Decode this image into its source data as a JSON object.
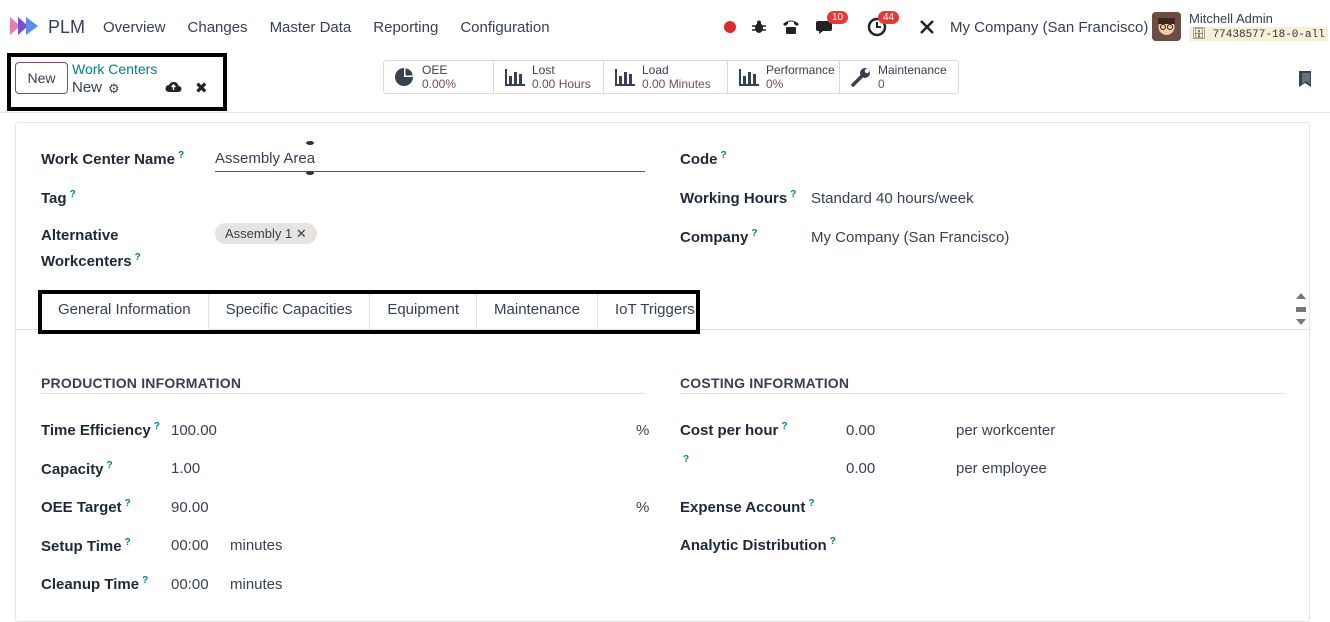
{
  "app": {
    "name": "PLM"
  },
  "nav": {
    "menu": [
      "Overview",
      "Changes",
      "Master Data",
      "Reporting",
      "Configuration"
    ]
  },
  "systray": {
    "messages_count": "10",
    "activities_count": "44",
    "company": "My Company (San Francisco)",
    "user_name": "Mitchell Admin",
    "db_name": "77438577-18-0-all"
  },
  "control": {
    "new_label": "New",
    "breadcrumb_parent": "Work Centers",
    "breadcrumb_current": "New"
  },
  "stats": [
    {
      "icon": "pie-chart-icon",
      "label": "OEE",
      "value": "0.00%"
    },
    {
      "icon": "bar-chart-icon",
      "label": "Lost",
      "value": "0.00 Hours"
    },
    {
      "icon": "bar-chart-icon",
      "label": "Load",
      "value": "0.00 Minutes"
    },
    {
      "icon": "bar-chart-icon",
      "label": "Performance",
      "value": "0%"
    },
    {
      "icon": "wrench-icon",
      "label": "Maintenance",
      "value": "0"
    }
  ],
  "form": {
    "name_label": "Work Center Name",
    "name_value": "Assembly Area",
    "tag_label": "Tag",
    "alt_label_1": "Alternative",
    "alt_label_2": "Workcenters",
    "alt_chip": "Assembly 1",
    "code_label": "Code",
    "hours_label": "Working Hours",
    "hours_value": "Standard 40 hours/week",
    "company_label": "Company",
    "company_value": "My Company (San Francisco)"
  },
  "tabs": [
    "General Information",
    "Specific Capacities",
    "Equipment",
    "Maintenance",
    "IoT Triggers"
  ],
  "production": {
    "title": "PRODUCTION INFORMATION",
    "efficiency_label": "Time Efficiency",
    "efficiency_value": "100.00",
    "efficiency_unit": "%",
    "capacity_label": "Capacity",
    "capacity_value": "1.00",
    "oee_label": "OEE Target",
    "oee_value": "90.00",
    "oee_unit": "%",
    "setup_label": "Setup Time",
    "setup_value": "00:00",
    "setup_unit": "minutes",
    "cleanup_label": "Cleanup Time",
    "cleanup_value": "00:00",
    "cleanup_unit": "minutes"
  },
  "costing": {
    "title": "COSTING INFORMATION",
    "cost_label": "Cost per hour",
    "cost_value": "0.00",
    "cost_unit": "per workcenter",
    "emp_value": "0.00",
    "emp_unit": "per employee",
    "expense_label": "Expense Account",
    "analytic_label": "Analytic Distribution"
  },
  "help_mark": "?"
}
